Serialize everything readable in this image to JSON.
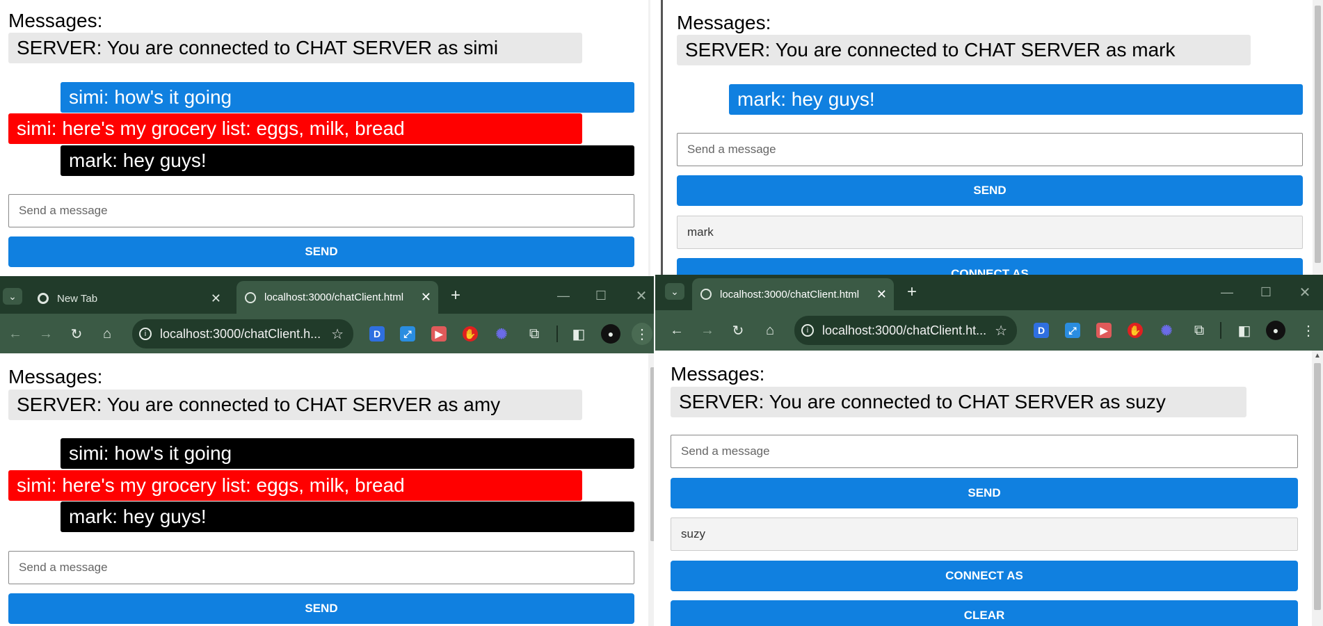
{
  "common": {
    "messages_label": "Messages:",
    "send_placeholder": "Send a message",
    "send_label": "SEND",
    "connect_label": "CONNECT AS",
    "clear_label": "CLEAR"
  },
  "panel_tl": {
    "server_msg": "SERVER: You are connected to CHAT SERVER as simi",
    "messages": [
      "simi: how's it going",
      "simi: here's my grocery list: eggs, milk, bread",
      "mark: hey guys!"
    ]
  },
  "panel_tr": {
    "server_msg": "SERVER: You are connected to CHAT SERVER as mark",
    "messages": [
      "mark: hey guys!"
    ],
    "name_value": "mark"
  },
  "panel_bl": {
    "server_msg": "SERVER: You are connected to CHAT SERVER as amy",
    "messages": [
      "simi: how's it going",
      "simi: here's my grocery list: eggs, milk, bread",
      "mark: hey guys!"
    ]
  },
  "panel_br": {
    "server_msg": "SERVER: You are connected to CHAT SERVER as suzy",
    "name_value": "suzy"
  },
  "browser_bl": {
    "tabs": [
      "New Tab",
      "localhost:3000/chatClient.html"
    ],
    "url": "localhost:3000/chatClient.h..."
  },
  "browser_br": {
    "tabs": [
      "localhost:3000/chatClient.html"
    ],
    "url": "localhost:3000/chatClient.ht..."
  },
  "icons": {
    "tab_search": "chevron-down-icon",
    "new_tab": "plus-icon",
    "back": "arrow-left-icon",
    "forward": "arrow-right-icon",
    "reload": "reload-icon",
    "home": "home-icon",
    "site_info": "info-icon",
    "bookmark": "star-icon",
    "extensions": "puzzle-icon",
    "side_panel": "side-panel-icon",
    "profile": "avatar",
    "menu": "kebab-menu-icon"
  },
  "colors": {
    "blue_bubble": "#1080e0",
    "black_bubble": "#000000",
    "red_bubble": "#ff0000",
    "server_bubble": "#e8e8e8",
    "chrome_frame": "#213b2a",
    "chrome_toolbar": "#3b5a45"
  }
}
